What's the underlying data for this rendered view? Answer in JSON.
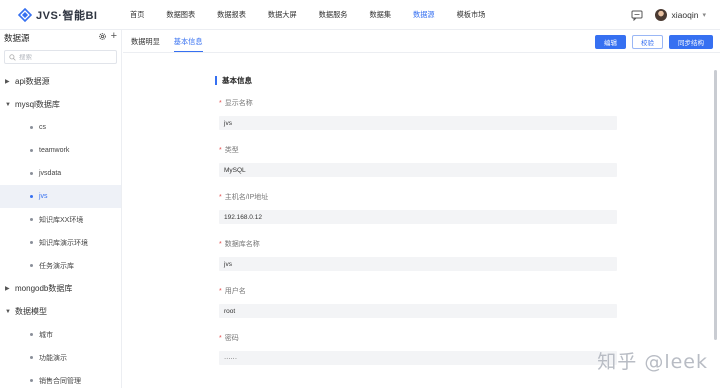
{
  "app": {
    "logo_text": "JVS·智能BI",
    "brand_color": "#3670f1"
  },
  "nav": {
    "items": [
      {
        "label": "首页",
        "active": false
      },
      {
        "label": "数据图表",
        "active": false
      },
      {
        "label": "数据报表",
        "active": false
      },
      {
        "label": "数据大屏",
        "active": false
      },
      {
        "label": "数据服务",
        "active": false
      },
      {
        "label": "数据集",
        "active": false
      },
      {
        "label": "数据源",
        "active": true
      },
      {
        "label": "模板市场",
        "active": false
      }
    ]
  },
  "user": {
    "name": "xiaoqin"
  },
  "sidebar": {
    "title": "数据源",
    "search_placeholder": "搜索",
    "tree": [
      {
        "type": "folder",
        "label": "api数据源",
        "expanded": false
      },
      {
        "type": "folder",
        "label": "mysql数据库",
        "expanded": true
      },
      {
        "type": "leaf",
        "label": "cs"
      },
      {
        "type": "leaf",
        "label": "teamwork"
      },
      {
        "type": "leaf",
        "label": "jvsdata"
      },
      {
        "type": "leaf",
        "label": "jvs",
        "selected": true
      },
      {
        "type": "leaf",
        "label": "知识库XX环境"
      },
      {
        "type": "leaf",
        "label": "知识库演示环境"
      },
      {
        "type": "leaf",
        "label": "任务演示库"
      },
      {
        "type": "folder",
        "label": "mongodb数据库",
        "expanded": false
      },
      {
        "type": "folder",
        "label": "数据模型",
        "expanded": true
      },
      {
        "type": "leaf",
        "label": "城市"
      },
      {
        "type": "leaf",
        "label": "功能演示"
      },
      {
        "type": "leaf",
        "label": "销售合同管理"
      }
    ]
  },
  "main": {
    "tabs": [
      {
        "label": "数据明显",
        "active": false
      },
      {
        "label": "基本信息",
        "active": true
      }
    ],
    "buttons": {
      "edit": "编辑",
      "verify": "校验",
      "sync": "同步结构"
    },
    "section_title": "基本信息",
    "fields": [
      {
        "label": "显示名称",
        "value": "jvs"
      },
      {
        "label": "类型",
        "value": "MySQL"
      },
      {
        "label": "主机名/IP地址",
        "value": "192.168.0.12"
      },
      {
        "label": "数据库名称",
        "value": "jvs"
      },
      {
        "label": "用户名",
        "value": "root"
      },
      {
        "label": "密码",
        "value": "······"
      }
    ]
  },
  "watermark": "知乎 @leek"
}
